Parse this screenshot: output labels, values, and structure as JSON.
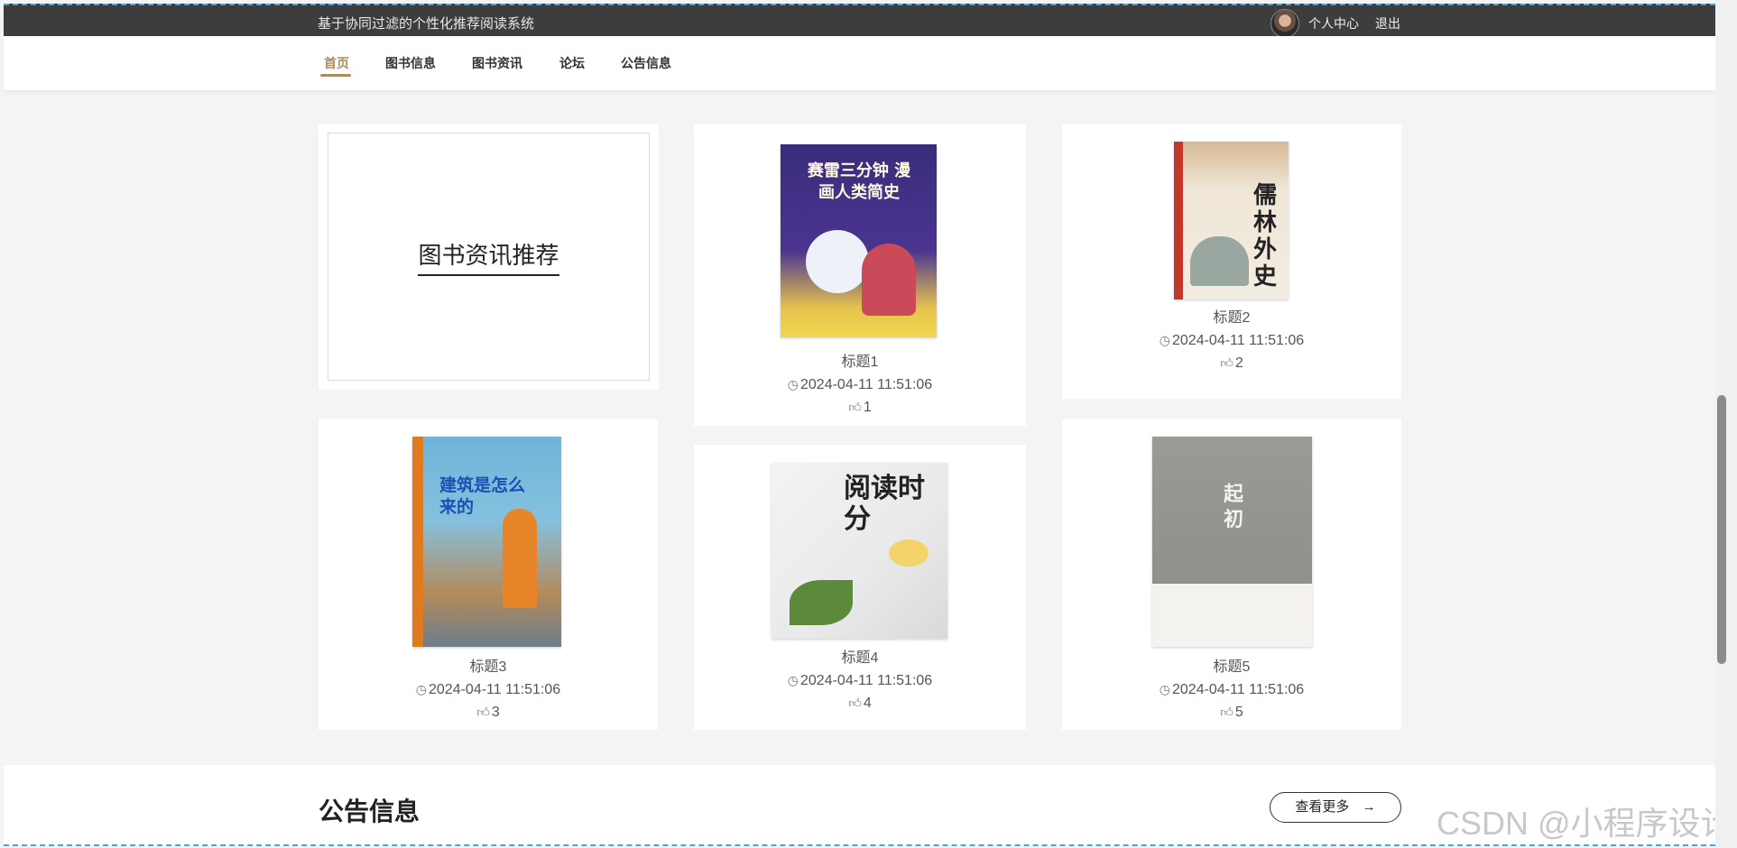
{
  "header": {
    "site_title": "基于协同过滤的个性化推荐阅读系统",
    "user_center_label": "个人中心",
    "logout_label": "退出"
  },
  "nav": {
    "items": [
      {
        "label": "首页",
        "active": true
      },
      {
        "label": "图书信息",
        "active": false
      },
      {
        "label": "图书资讯",
        "active": false
      },
      {
        "label": "论坛",
        "active": false
      },
      {
        "label": "公告信息",
        "active": false
      }
    ]
  },
  "promo": {
    "label": "图书资讯推荐"
  },
  "articles": [
    {
      "title": "标题1",
      "date": "2024-04-11 11:51:06",
      "likes": "1",
      "cover_text": "赛雷三分钟 漫画人类简史"
    },
    {
      "title": "标题2",
      "date": "2024-04-11 11:51:06",
      "likes": "2",
      "cover_text": "儒林外史"
    },
    {
      "title": "标题3",
      "date": "2024-04-11 11:51:06",
      "likes": "3",
      "cover_text": "建筑是怎么来的"
    },
    {
      "title": "标题4",
      "date": "2024-04-11 11:51:06",
      "likes": "4",
      "cover_text": "阅读时分"
    },
    {
      "title": "标题5",
      "date": "2024-04-11 11:51:06",
      "likes": "5",
      "cover_text": "起初"
    }
  ],
  "notice": {
    "section_title": "公告信息",
    "more_label": "查看更多",
    "more_arrow": "→"
  },
  "watermark": "CSDN @小程序设计",
  "icons": {
    "clock": "clock-icon",
    "like": "thumbs-up-icon"
  },
  "colors": {
    "topbar": "#3d3d3d",
    "accent": "#b08a63",
    "page_bg": "#f4f4f4"
  }
}
